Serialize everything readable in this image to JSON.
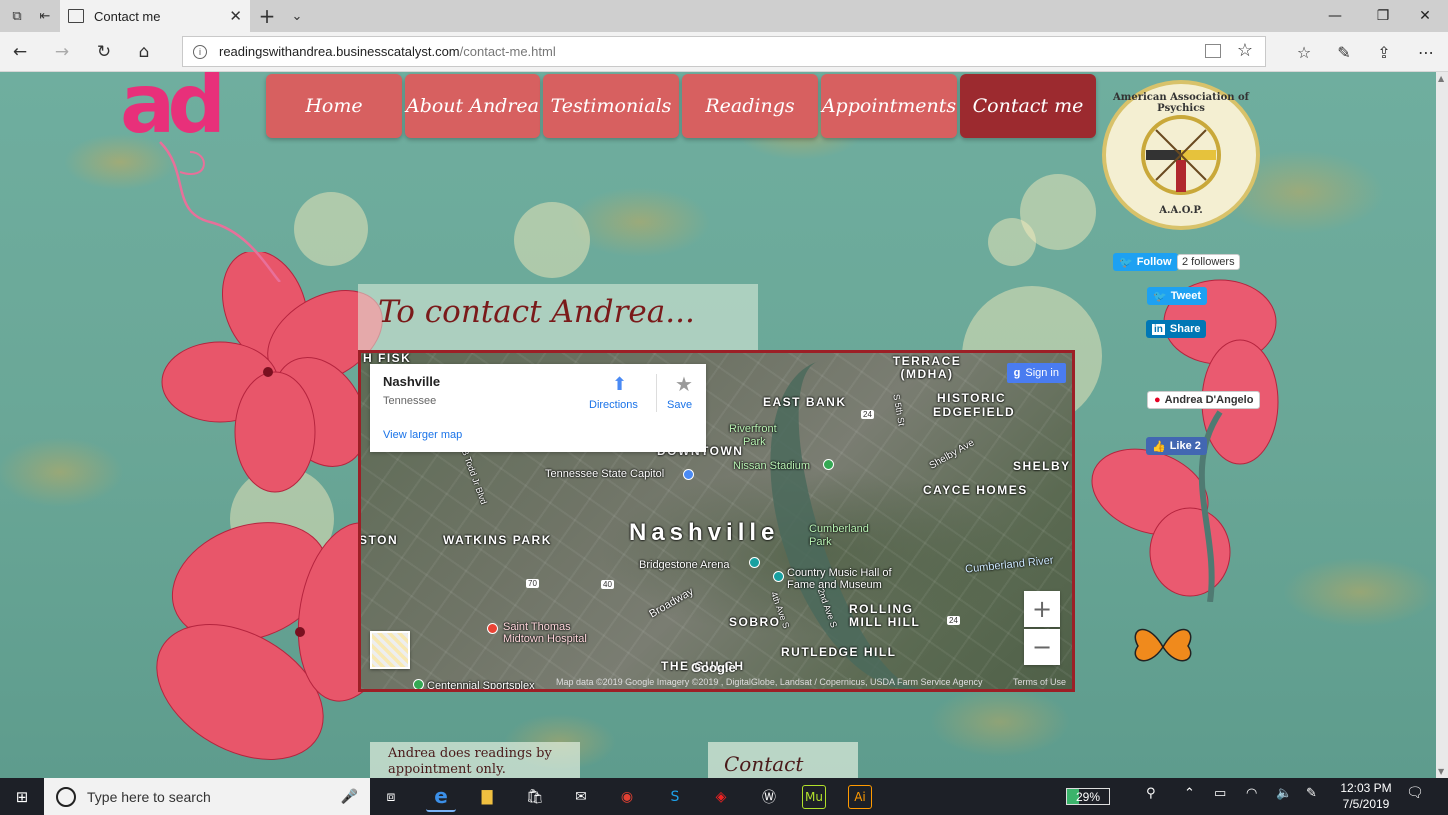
{
  "browser": {
    "tab_title": "Contact me",
    "url_host": "readingswithandrea.businesscatalyst.com",
    "url_path": "/contact-me.html"
  },
  "site": {
    "logo_text": "ad",
    "nav": [
      {
        "label": "Home"
      },
      {
        "label": "About Andrea"
      },
      {
        "label": "Testimonials"
      },
      {
        "label": "Readings"
      },
      {
        "label": "Appointments"
      },
      {
        "label": "Contact me"
      }
    ],
    "badge": {
      "ring_text": "American Association of Psychics",
      "bottom_text": "A.A.O.P."
    },
    "social": {
      "follow": "Follow",
      "followers": "2 followers",
      "tweet": "Tweet",
      "share": "Share",
      "pinterest": "Andrea D'Angelo",
      "like": "Like 2"
    },
    "heading": "To contact Andrea...",
    "note": "Andrea does readings by appointment only.",
    "form_title": "Contact Form"
  },
  "map": {
    "place": "Nashville",
    "region": "Tennessee",
    "directions": "Directions",
    "save": "Save",
    "larger_map": "View larger map",
    "sign_in": "Sign in",
    "zoom_in": "+",
    "zoom_out": "−",
    "labels": {
      "fisk": "H FISK",
      "terrace": "TERRACE (MDHA)",
      "historic": "HISTORIC",
      "edgefield": "EDGEFIELD",
      "east_bank": "EAST BANK",
      "riverfront": "Riverfront",
      "park": "Park",
      "downtown": "DOWNTOWN",
      "capitol": "Tennessee State Capitol",
      "stadium": "Nissan Stadium",
      "shelby_ave": "Shelby Ave",
      "shelby": "SHELBY",
      "cayce": "CAYCE HOMES",
      "watkins": "WATKINS PARK",
      "nashville": "Nashville",
      "cumberland_park": "Cumberland Park",
      "bridgestone": "Bridgestone Arena",
      "country_music": "Country Music Hall of Fame and Museum",
      "cumberland_river": "Cumberland River",
      "broadway": "Broadway",
      "saint_thomas": "Saint Thomas Midtown Hospital",
      "sobro": "SOBRO",
      "rolling": "ROLLING MILL HILL",
      "rutledge": "RUTLEDGE HILL",
      "the_gulch": "THE GULCH",
      "centennial": "Centennial Sportsplex",
      "db_todd": "Dr DB Todd Jr Blvd",
      "ston": "STON",
      "fourth_ave": "4th Ave S",
      "second_ave": "2nd Ave S",
      "fifth_st": "S 5th St"
    },
    "highways": [
      "24",
      "70",
      "40",
      "24"
    ],
    "attribution": "Map data ©2019 Google Imagery ©2019 , DigitalGlobe, Landsat / Copernicus, USDA Farm Service Agency",
    "terms": "Terms of Use",
    "google": "Google"
  },
  "taskbar": {
    "search_placeholder": "Type here to search",
    "battery": "29%",
    "time": "12:03 PM",
    "date": "7/5/2019"
  },
  "colors": {
    "nav_bg": "#d76060",
    "nav_active": "#9c2a2f",
    "logo": "#e8307a",
    "map_border": "#9c1f26",
    "page_bg": "#6aa89a"
  }
}
